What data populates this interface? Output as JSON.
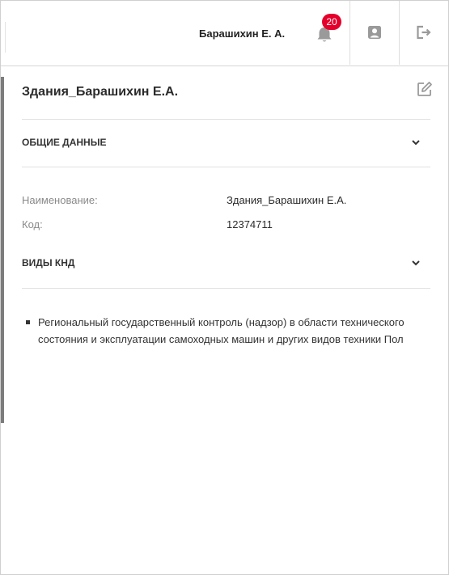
{
  "header": {
    "user_name": "Барашихин Е. А.",
    "notification_count": "20",
    "icons": {
      "notifications": "bell-icon",
      "profile": "user-card-icon",
      "logout": "logout-icon"
    }
  },
  "card": {
    "title": "Здания_Барашихин Е.А.",
    "edit_icon": "edit-icon",
    "sections": {
      "general": {
        "label": "ОБЩИЕ ДАННЫЕ",
        "fields": [
          {
            "label": "Наименование:",
            "value": "Здания_Барашихин Е.А."
          },
          {
            "label": "Код:",
            "value": "12374711"
          }
        ]
      },
      "knd": {
        "label": "ВИДЫ КНД",
        "items": [
          "Региональный государственный контроль (надзор) в области технического состояния и эксплуатации самоходных машин и других видов техники Пол"
        ]
      }
    }
  },
  "colors": {
    "badge": "#e4002b",
    "text": "#333333",
    "muted": "#8a8a8a",
    "divider": "#e1e1e1",
    "icon": "#9a9a9a"
  }
}
